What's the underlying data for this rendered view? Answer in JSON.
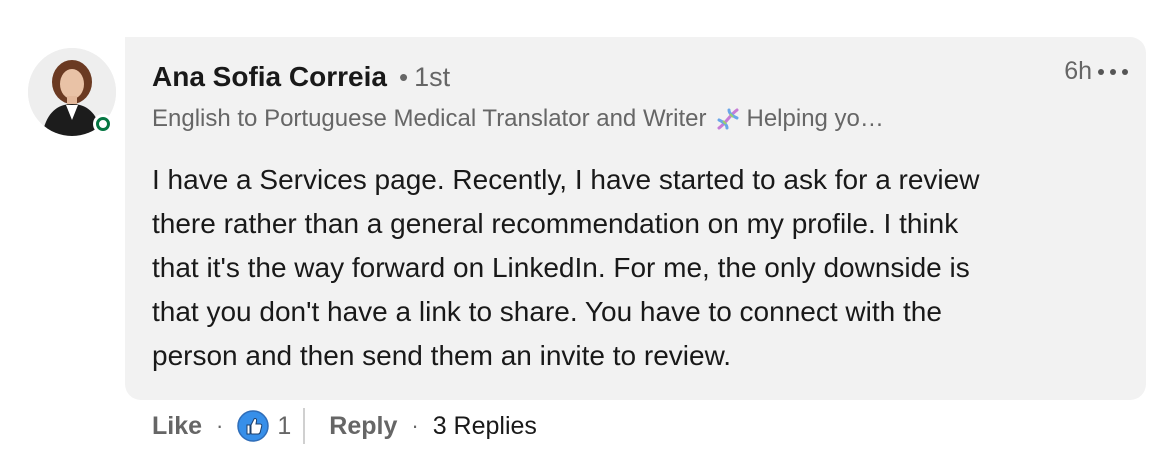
{
  "comment": {
    "author": {
      "name": "Ana Sofia Correia",
      "degree": "1st",
      "headline_before_icon": "English to Portuguese Medical Translator and Writer",
      "headline_icon": "dna-icon",
      "headline_after_icon": "Helping yo…",
      "avatar": "author-avatar",
      "presence": "online"
    },
    "time": "6h",
    "more_icon": "more-icon",
    "body": [
      "I have a Services page. Recently, I have started to ask for a review",
      "there rather than a general recommendation on my profile. I think",
      "that it's the way forward on LinkedIn. For me, the only downside is",
      "that you don't have a link to share. You have to connect with the",
      "person and then send them an invite to review."
    ],
    "actions": {
      "like_label": "Like",
      "reaction_icon": "thumbs-up-icon",
      "reaction_count": "1",
      "reply_label": "Reply",
      "replies_label": "3 Replies"
    }
  },
  "colors": {
    "bubble": "#f2f2f2",
    "presence": "#057642",
    "reaction": "#378fe9",
    "secondary_text": "#666666"
  }
}
